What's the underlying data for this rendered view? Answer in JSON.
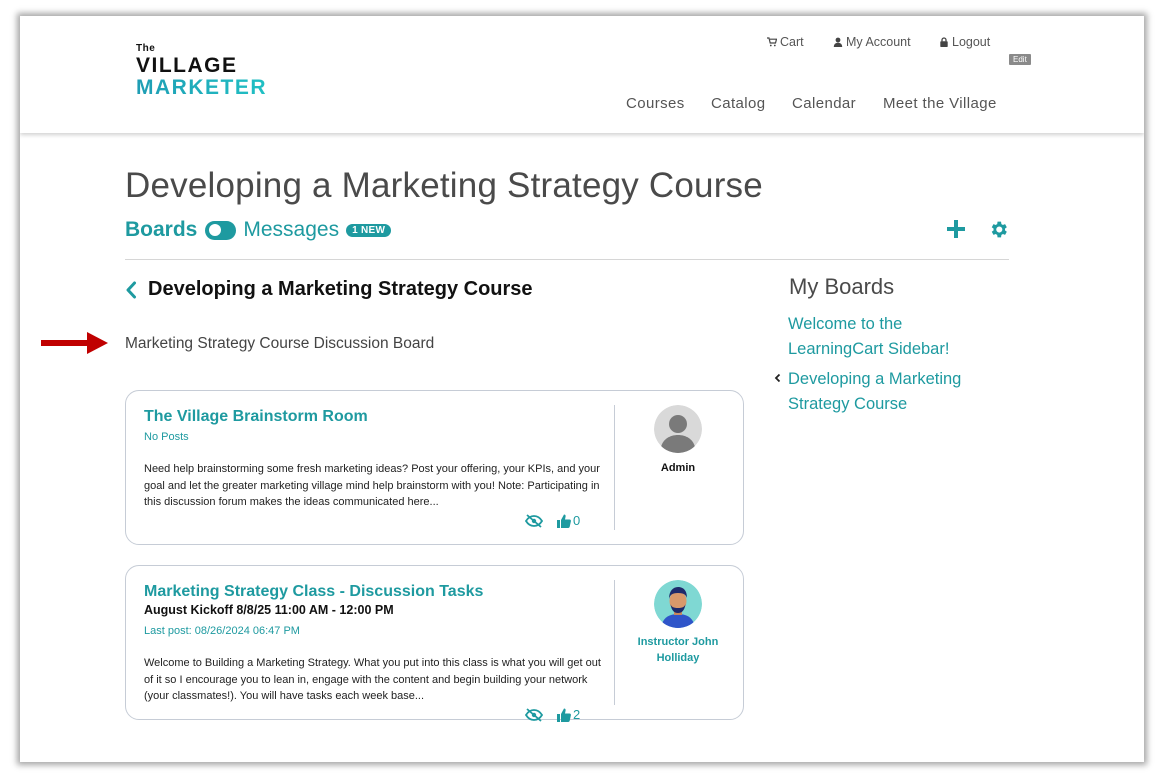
{
  "header": {
    "logo": {
      "line1": "The",
      "line2": "VILLAGE",
      "line3": "MARKETER"
    },
    "utility": {
      "cart": "Cart",
      "account": "My Account",
      "logout": "Logout"
    },
    "edit_label": "Edit",
    "nav": [
      "Courses",
      "Catalog",
      "Calendar",
      "Meet the Village"
    ]
  },
  "page": {
    "title": "Developing a Marketing Strategy Course",
    "tabs": {
      "boards": "Boards",
      "messages": "Messages",
      "new_badge": "1 NEW"
    },
    "board_heading": "Developing a Marketing Strategy Course",
    "subtitle": "Marketing Strategy Course Discussion Board"
  },
  "cards": [
    {
      "title": "The Village Brainstorm Room",
      "subtitle": "",
      "meta": "No Posts",
      "description": "Need help brainstorming some fresh marketing ideas? Post your offering, your KPIs, and your goal and let the greater marketing village mind help brainstorm with you! Note: Participating in this discussion forum makes the ideas communicated here...",
      "likes": "0",
      "author": "Admin"
    },
    {
      "title": "Marketing Strategy Class - Discussion Tasks",
      "subtitle": "August Kickoff 8/8/25 11:00 AM - 12:00 PM",
      "meta": "Last post: 08/26/2024 06:47 PM",
      "description": "Welcome to Building a Marketing Strategy. What you put into this class is what you will get out of it so I encourage you to lean in, engage with the content and begin building your network (your classmates!).  You will have tasks each week base...",
      "likes": "2",
      "author": "Instructor John Holliday"
    }
  ],
  "sidebar": {
    "title": "My Boards",
    "links": [
      "Welcome to the LearningCart Sidebar!",
      "Developing a Marketing Strategy Course"
    ]
  },
  "colors": {
    "accent": "#1e9aa0",
    "text": "#4a4a4a",
    "arrow": "#c00000"
  },
  "icons": [
    "cart-icon",
    "user-icon",
    "lock-icon",
    "plus-icon",
    "gear-icon",
    "chevron-left-icon",
    "hide-icon",
    "thumbs-up-icon",
    "arrow-right-icon"
  ]
}
